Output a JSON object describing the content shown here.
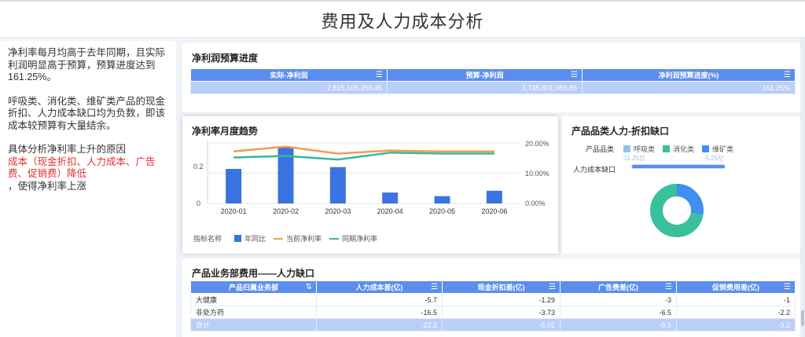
{
  "page": {
    "title": "费用及人力成本分析"
  },
  "analysis": {
    "para1": "净利率每月均高于去年同期，且实际利润明显高于预算，预算进度达到161.25%。",
    "para2": "呼吸类、消化类、维矿类产品的现金折扣、人力成本缺口均为负数，即该成本较预算有大量结余。",
    "para3_intro": "具体分析净利率上升的原因",
    "para3_red": "成本（现金折扣、人力成本、广告费、促销费）降低",
    "para3_tail": "，使得净利率上涨"
  },
  "budget": {
    "title": "净利润预算进度",
    "columns": [
      "实际-净利润",
      "预算-净利润",
      "净利润预算进度(%)"
    ],
    "values": [
      "2,815,105,260.46",
      "1,745,601,058.86",
      "161.25%"
    ]
  },
  "trend": {
    "title": "净利率月度趋势",
    "legend_prefix": "指标名称",
    "left_ticks": [
      "0.2",
      "0"
    ],
    "right_ticks": [
      "20.00%",
      "10.00%",
      "0.00%"
    ]
  },
  "category": {
    "title": "产品品类人力-折扣缺口",
    "legend_label": "产品品类",
    "legend_items": [
      "呼吸类",
      "消化类",
      "维矿类"
    ],
    "legend_colors": [
      "#8fc3f2",
      "#39c19e",
      "#3d8ff0"
    ],
    "gap_label": "人力成本缺口",
    "left_value": "-11.25亿",
    "right_value": "-5.25亿"
  },
  "dept": {
    "title": "产品业务部费用——人力缺口",
    "columns": [
      "产品归属业务部",
      "人力成本差(亿)",
      "现金折扣差(亿)",
      "广告费差(亿)",
      "促销费用差(亿)"
    ],
    "rows": [
      [
        "大健康",
        "-5.7",
        "-1.29",
        "-3",
        "-1"
      ],
      [
        "非处方药",
        "-16.5",
        "-3.73",
        "-6.5",
        "-2.2"
      ],
      [
        "合计",
        "-22.2",
        "-5.02",
        "-9.5",
        "-3.2"
      ]
    ]
  },
  "chart_data": {
    "type": "bar",
    "title": "净利率月度趋势",
    "categories": [
      "2020-01",
      "2020-02",
      "2020-03",
      "2020-04",
      "2020-05",
      "2020-06"
    ],
    "ylim": [
      0,
      0.35
    ],
    "y2lim": [
      0,
      0.2
    ],
    "series": [
      {
        "name": "年同比",
        "kind": "bar",
        "axis": "left",
        "color": "#3b73e0",
        "values": [
          0.19,
          0.31,
          0.2,
          0.06,
          0.04,
          0.07
        ]
      },
      {
        "name": "当前净利率",
        "kind": "line",
        "axis": "right",
        "color": "#f39b4d",
        "values": [
          0.172,
          0.188,
          0.165,
          0.175,
          0.172,
          0.172
        ]
      },
      {
        "name": "同期净利率",
        "kind": "line",
        "axis": "right",
        "color": "#36b89a",
        "values": [
          0.152,
          0.157,
          0.145,
          0.168,
          0.165,
          0.165
        ]
      }
    ],
    "legend_position": "bottom-left",
    "grid": true
  }
}
